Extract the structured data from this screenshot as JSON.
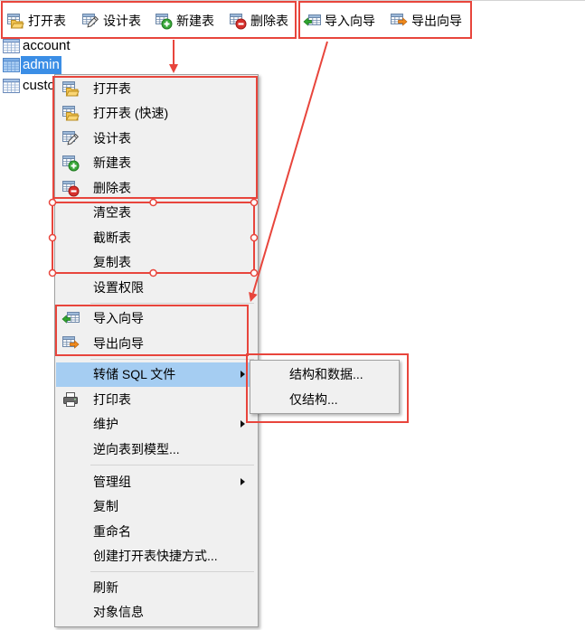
{
  "toolbar": {
    "left_group": [
      {
        "label": "打开表",
        "icon": "open-table-icon"
      },
      {
        "label": "设计表",
        "icon": "design-table-icon"
      },
      {
        "label": "新建表",
        "icon": "new-table-icon"
      },
      {
        "label": "删除表",
        "icon": "delete-table-icon"
      }
    ],
    "right_group": [
      {
        "label": "导入向导",
        "icon": "import-wizard-icon"
      },
      {
        "label": "导出向导",
        "icon": "export-wizard-icon"
      }
    ]
  },
  "object_tree": {
    "items": [
      {
        "label": "account",
        "icon": "table-icon",
        "selected": false
      },
      {
        "label": "admin",
        "icon": "table-icon",
        "selected": true
      },
      {
        "label": "custo",
        "icon": "table-icon",
        "selected": false
      }
    ]
  },
  "context_menu": {
    "items": [
      {
        "label": "打开表",
        "icon": "open-table-icon"
      },
      {
        "label": "打开表 (快速)",
        "icon": "open-table-icon"
      },
      {
        "label": "设计表",
        "icon": "design-table-icon"
      },
      {
        "label": "新建表",
        "icon": "new-table-icon"
      },
      {
        "label": "删除表",
        "icon": "delete-table-icon"
      },
      {
        "label": "清空表"
      },
      {
        "label": "截断表"
      },
      {
        "label": "复制表"
      },
      {
        "label": "设置权限"
      },
      {
        "label": "导入向导",
        "icon": "import-wizard-icon"
      },
      {
        "label": "导出向导",
        "icon": "export-wizard-icon"
      },
      {
        "label": "转储 SQL 文件",
        "has_submenu": true,
        "highlighted": true
      },
      {
        "label": "打印表",
        "icon": "printer-icon"
      },
      {
        "label": "维护",
        "has_submenu": true
      },
      {
        "label": "逆向表到模型..."
      },
      {
        "label": "管理组",
        "has_submenu": true
      },
      {
        "label": "复制"
      },
      {
        "label": "重命名"
      },
      {
        "label": "创建打开表快捷方式..."
      },
      {
        "label": "刷新"
      },
      {
        "label": "对象信息"
      }
    ]
  },
  "submenu": {
    "items": [
      {
        "label": "结构和数据..."
      },
      {
        "label": "仅结构..."
      }
    ]
  },
  "colors": {
    "annotation_red": "#e8453c",
    "tree_selection": "#3b8ee6",
    "menu_highlight": "#a5cdf2",
    "menu_background": "#f0f0f0"
  }
}
